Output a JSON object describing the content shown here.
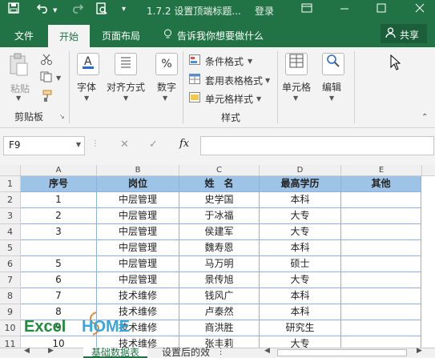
{
  "title_bar": {
    "filename": "1.7.2 设置顶端标题...",
    "login": "登录",
    "icons": [
      "save-icon",
      "undo-icon",
      "redo-icon",
      "print-preview-icon",
      "qat-dropdown-icon",
      "restore-icon",
      "minimize-icon",
      "maximize-icon",
      "close-icon"
    ]
  },
  "ribbon_tabs": {
    "file": "文件",
    "home": "开始",
    "page_layout": "页面布局",
    "tell_me": "告诉我你想要做什么",
    "share": "共享"
  },
  "ribbon": {
    "paste": "粘贴",
    "clipboard": "剪贴板",
    "font": "字体",
    "alignment": "对齐方式",
    "number": "数字",
    "number_symbol": "%",
    "conditional_format": "条件格式",
    "table_format": "套用表格格式",
    "cell_style": "单元格样式",
    "styles": "样式",
    "cells": "单元格",
    "editing": "编辑"
  },
  "formula_bar": {
    "name_box": "F9",
    "fx": "fx",
    "cancel": "✕",
    "confirm": "✓",
    "content": ""
  },
  "grid": {
    "columns": [
      "A",
      "B",
      "C",
      "D",
      "E"
    ],
    "header_row": [
      "序号",
      "岗位",
      "姓　名",
      "最高学历",
      "其他"
    ],
    "rows": [
      {
        "num": "2",
        "a": "1",
        "b": "中层管理",
        "c": "史学国",
        "d": "本科",
        "e": ""
      },
      {
        "num": "3",
        "a": "2",
        "b": "中层管理",
        "c": "于冰福",
        "d": "大专",
        "e": ""
      },
      {
        "num": "4",
        "a": "3",
        "b": "中层管理",
        "c": "侯建军",
        "d": "大专",
        "e": ""
      },
      {
        "num": "5",
        "a": "",
        "b": "中层管理",
        "c": "魏寿恩",
        "d": "本科",
        "e": ""
      },
      {
        "num": "6",
        "a": "5",
        "b": "中层管理",
        "c": "马万明",
        "d": "硕士",
        "e": ""
      },
      {
        "num": "7",
        "a": "6",
        "b": "中层管理",
        "c": "景传旭",
        "d": "大专",
        "e": ""
      },
      {
        "num": "8",
        "a": "7",
        "b": "技术维修",
        "c": "钱风广",
        "d": "本科",
        "e": ""
      },
      {
        "num": "9",
        "a": "8",
        "b": "技术维修",
        "c": "卢泰然",
        "d": "本科",
        "e": ""
      },
      {
        "num": "10",
        "a": "9",
        "b": "技术维修",
        "c": "商洪胜",
        "d": "研究生",
        "e": ""
      },
      {
        "num": "11",
        "a": "10",
        "b": "技术维修",
        "c": "张丰莉",
        "d": "大专",
        "e": ""
      }
    ],
    "first_row_num": "1"
  },
  "sheet_tabs": {
    "tab1": "基础数据表",
    "tab2": "设置后的效"
  },
  "watermark": "ExcelHOME",
  "colors": {
    "excel_green": "#217346",
    "header_blue": "#9dc3e6",
    "grid_line_blue": "#8fb0dc",
    "watermark_green": "#1e8c3a",
    "watermark_blue": "#3aa6e0"
  }
}
